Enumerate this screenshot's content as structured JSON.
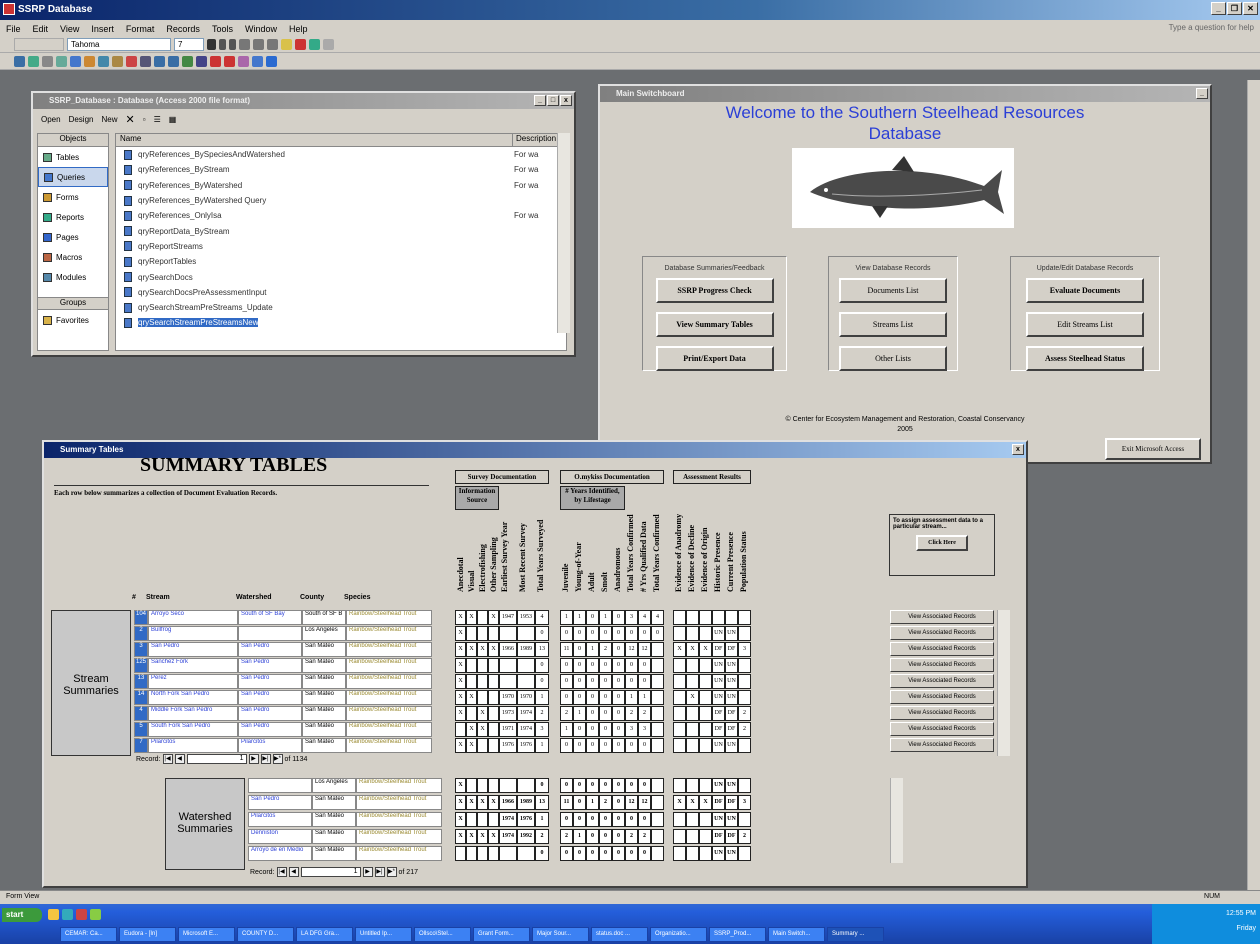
{
  "app": {
    "title": "SSRP Database",
    "help_placeholder": "Type a question for help"
  },
  "menu": [
    "File",
    "Edit",
    "View",
    "Insert",
    "Format",
    "Records",
    "Tools",
    "Window",
    "Help"
  ],
  "format_toolbar": {
    "font": "Tahoma",
    "size": "7"
  },
  "db_window": {
    "title": "SSRP_Database : Database (Access 2000 file format)",
    "toolbar": {
      "open": "Open",
      "design": "Design",
      "new": "New"
    },
    "objects_header": "Objects",
    "objects": [
      "Tables",
      "Queries",
      "Forms",
      "Reports",
      "Pages",
      "Macros",
      "Modules"
    ],
    "groups_header": "Groups",
    "groups": [
      "Favorites"
    ],
    "col_name": "Name",
    "col_desc": "Description",
    "queries": [
      {
        "name": "qryReferences_BySpeciesAndWatershed",
        "desc": "For wa"
      },
      {
        "name": "qryReferences_ByStream",
        "desc": "For wa"
      },
      {
        "name": "qryReferences_ByWatershed",
        "desc": "For wa"
      },
      {
        "name": "qryReferences_ByWatershed Query",
        "desc": ""
      },
      {
        "name": "qryReferences_OnlyIsa",
        "desc": "For wa"
      },
      {
        "name": "qryReportData_ByStream",
        "desc": ""
      },
      {
        "name": "qryReportStreams",
        "desc": ""
      },
      {
        "name": "qryReportTables",
        "desc": ""
      },
      {
        "name": "qrySearchDocs",
        "desc": ""
      },
      {
        "name": "qrySearchDocsPreAssessmentInput",
        "desc": ""
      },
      {
        "name": "qrySearchStreamPreStreams_Update",
        "desc": ""
      },
      {
        "name": "qrySearchStreamPreStreamsNew",
        "desc": ""
      }
    ]
  },
  "main_form": {
    "title": "Main Switchboard",
    "welcome_line1": "Welcome to the Southern Steelhead Resources",
    "welcome_line2": "Database",
    "group1": {
      "label": "Database Summaries/Feedback",
      "buttons": [
        "SSRP Progress Check",
        "View Summary Tables",
        "Print/Export Data"
      ]
    },
    "group2": {
      "label": "View Database Records",
      "buttons": [
        "Documents List",
        "Streams List",
        "Other Lists"
      ]
    },
    "group3": {
      "label": "Update/Edit Database Records",
      "buttons": [
        "Evaluate Documents",
        "Edit Streams List",
        "Assess Steelhead Status"
      ]
    },
    "credit": "© Center for Ecosystem Management and Restoration, Coastal Conservancy",
    "year": "2005",
    "exit_button": "Exit Microsoft Access"
  },
  "summary": {
    "window_title": "Summary Tables",
    "heading": "SUMMARY TABLES",
    "subheading": "Each row below summarizes a collection of Document Evaluation Records.",
    "grp_survey": "Survey Documentation",
    "grp_info": "Information Source",
    "grp_omykiss": "O.mykiss Documentation",
    "grp_years": "# Years Identified, by Lifestage",
    "grp_assess": "Assessment Results",
    "vcols": [
      "Anecdotal",
      "Visual",
      "Electrofishing",
      "Other Sampling",
      "Earliest Survey Year",
      "Most Recent Survey",
      "Total Years Surveyed",
      "Juvenile",
      "Young-of-Year",
      "Adult",
      "Smolt",
      "Anadromous",
      "Total Years Confirmed",
      "# Yrs Qualified Data",
      "Total Years Confirmed",
      "Evidence of Anadromy",
      "Evidence of Decline",
      "Evidence of Origin",
      "Historic Presence",
      "Current Presence",
      "Population Status"
    ],
    "assign_text": "To assign assessment data to a particular stream...",
    "click_here": "Click Here",
    "cols": {
      "num": "#",
      "stream": "Stream",
      "watershed": "Watershed",
      "county": "County",
      "species": "Species"
    },
    "stream_label": "Stream Summaries",
    "watershed_label": "Watershed Summaries",
    "view_button": "View Associated Records",
    "stream_rows": [
      {
        "id": "104",
        "stream": "Arroyo Seco",
        "ws": "South of SF Bay",
        "county": "South of SF B",
        "sp": "Rainbow/Steelhead Trout",
        "v": [
          "X",
          "X",
          "",
          "X",
          "1947",
          "1953",
          "4",
          "1",
          "1",
          "0",
          "1",
          "0",
          "3",
          "4",
          "4",
          "",
          "",
          "",
          "",
          "",
          ""
        ]
      },
      {
        "id": "2",
        "stream": "Bullfrog",
        "ws": "",
        "county": "Los Angeles",
        "sp": "Rainbow/Steelhead Trout",
        "v": [
          "X",
          "",
          "",
          "",
          "",
          "",
          "0",
          "0",
          "0",
          "0",
          "0",
          "0",
          "0",
          "0",
          "0",
          "",
          "",
          "",
          "UN",
          "UN",
          ""
        ]
      },
      {
        "id": "3",
        "stream": "San Pedro",
        "ws": "San Pedro",
        "county": "San Mateo",
        "sp": "Rainbow/Steelhead Trout",
        "v": [
          "X",
          "X",
          "X",
          "X",
          "1966",
          "1989",
          "13",
          "11",
          "0",
          "1",
          "2",
          "0",
          "12",
          "12",
          "",
          "X",
          "X",
          "X",
          "DF",
          "DF",
          "3"
        ]
      },
      {
        "id": "125",
        "stream": "Sanchez Fork",
        "ws": "San Pedro",
        "county": "San Mateo",
        "sp": "Rainbow/Steelhead Trout",
        "v": [
          "X",
          "",
          "",
          "",
          "",
          "",
          "0",
          "0",
          "0",
          "0",
          "0",
          "0",
          "0",
          "0",
          "",
          "",
          "",
          "",
          "UN",
          "UN",
          ""
        ]
      },
      {
        "id": "13",
        "stream": "Perez",
        "ws": "San Pedro",
        "county": "San Mateo",
        "sp": "Rainbow/Steelhead Trout",
        "v": [
          "X",
          "",
          "",
          "",
          "",
          "",
          "0",
          "0",
          "0",
          "0",
          "0",
          "0",
          "0",
          "0",
          "",
          "",
          "",
          "",
          "UN",
          "UN",
          ""
        ]
      },
      {
        "id": "14",
        "stream": "North Fork San Pedro",
        "ws": "San Pedro",
        "county": "San Mateo",
        "sp": "Rainbow/Steelhead Trout",
        "v": [
          "X",
          "X",
          "",
          "",
          "1970",
          "1970",
          "1",
          "0",
          "0",
          "0",
          "0",
          "0",
          "1",
          "1",
          "",
          "",
          "X",
          "",
          "UN",
          "UN",
          ""
        ]
      },
      {
        "id": "4",
        "stream": "Middle Fork San Pedro",
        "ws": "San Pedro",
        "county": "San Mateo",
        "sp": "Rainbow/Steelhead Trout",
        "v": [
          "X",
          "",
          "X",
          "",
          "1973",
          "1974",
          "2",
          "2",
          "1",
          "0",
          "0",
          "0",
          "2",
          "2",
          "",
          "",
          "",
          "",
          "DF",
          "DF",
          "2"
        ]
      },
      {
        "id": "5",
        "stream": "South Fork San Pedro",
        "ws": "San Pedro",
        "county": "San Mateo",
        "sp": "Rainbow/Steelhead Trout",
        "v": [
          "",
          "X",
          "X",
          "",
          "1971",
          "1974",
          "3",
          "1",
          "0",
          "0",
          "0",
          "0",
          "3",
          "3",
          "",
          "",
          "",
          "",
          "DF",
          "DF",
          "2"
        ]
      },
      {
        "id": "7",
        "stream": "Pilarcitos",
        "ws": "Pilarcitos",
        "county": "San Mateo",
        "sp": "Rainbow/Steelhead Trout",
        "v": [
          "X",
          "X",
          "",
          "",
          "1976",
          "1976",
          "1",
          "0",
          "0",
          "0",
          "0",
          "0",
          "0",
          "0",
          "",
          "",
          "",
          "",
          "UN",
          "UN",
          ""
        ]
      }
    ],
    "stream_nav": {
      "label": "Record:",
      "current": "1",
      "total": "of 1134"
    },
    "watershed_rows": [
      {
        "ws": "",
        "county": "Los Angeles",
        "sp": "Rainbow/Steelhead Trout",
        "v": [
          "X",
          "",
          "",
          "",
          "",
          "",
          "0",
          "0",
          "0",
          "0",
          "0",
          "0",
          "0",
          "0",
          "",
          "",
          "",
          "",
          "UN",
          "UN",
          ""
        ]
      },
      {
        "ws": "San Pedro",
        "county": "San Mateo",
        "sp": "Rainbow/Steelhead Trout",
        "v": [
          "X",
          "X",
          "X",
          "X",
          "1966",
          "1989",
          "13",
          "11",
          "0",
          "1",
          "2",
          "0",
          "12",
          "12",
          "",
          "X",
          "X",
          "X",
          "DF",
          "DF",
          "3"
        ]
      },
      {
        "ws": "Pilarcitos",
        "county": "San Mateo",
        "sp": "Rainbow/Steelhead Trout",
        "v": [
          "X",
          "",
          "",
          "",
          "1974",
          "1976",
          "1",
          "0",
          "0",
          "0",
          "0",
          "0",
          "0",
          "0",
          "",
          "",
          "",
          "",
          "UN",
          "UN",
          ""
        ]
      },
      {
        "ws": "Denniston",
        "county": "San Mateo",
        "sp": "Rainbow/Steelhead Trout",
        "v": [
          "X",
          "X",
          "X",
          "X",
          "1974",
          "1992",
          "2",
          "2",
          "1",
          "0",
          "0",
          "0",
          "2",
          "2",
          "",
          "",
          "",
          "",
          "DF",
          "DF",
          "2"
        ]
      },
      {
        "ws": "Arroyo de en Medio",
        "county": "San Mateo",
        "sp": "Rainbow/Steelhead Trout",
        "v": [
          "",
          "",
          "",
          "",
          "",
          "",
          "0",
          "0",
          "0",
          "0",
          "0",
          "0",
          "0",
          "0",
          "",
          "",
          "",
          "",
          "UN",
          "UN",
          ""
        ]
      }
    ],
    "watershed_nav": {
      "label": "Record:",
      "current": "1",
      "total": "of 217"
    }
  },
  "statusbar": {
    "left": "Form View",
    "right": "NUM"
  },
  "taskbar": {
    "start": "start",
    "items": [
      "CEMAR: Ca...",
      "Eudora - [In]",
      "Microsoft E...",
      "COUNTY D...",
      "LA DFG Gra...",
      "Untitled Ip...",
      "Ollsco\\Stel...",
      "Grant Form...",
      "Major Sour...",
      "status.doc ...",
      "Organizatio...",
      "SSRP_Prod...",
      "Main Switch...",
      "Summary ..."
    ],
    "time": "12:55 PM",
    "day": "Friday"
  }
}
